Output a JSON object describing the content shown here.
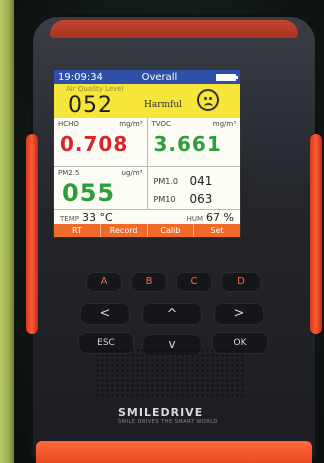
{
  "status_bar": {
    "time": "19:09:34",
    "mode": "Overall"
  },
  "aqi": {
    "caption": "Air Quality Level",
    "value": "052",
    "level": "Harmful"
  },
  "hcho": {
    "label": "HCHO",
    "unit": "mg/m³",
    "value": "0.708"
  },
  "tvoc": {
    "label": "TVOC",
    "unit": "mg/m³",
    "value": "3.661"
  },
  "pm25": {
    "label": "PM2.5",
    "unit": "ug/m³",
    "value": "055"
  },
  "pm1": {
    "label": "PM1.0",
    "value": "041"
  },
  "pm10": {
    "label": "PM10",
    "value": "063"
  },
  "temp": {
    "label": "TEMP",
    "value": "33 °C"
  },
  "hum": {
    "label": "HUM",
    "value": "67 %"
  },
  "menu": [
    "RT",
    "Record",
    "Calib",
    "Set"
  ],
  "keys": {
    "a": "A",
    "b": "B",
    "c": "C",
    "d": "D",
    "left": "<",
    "up": "^",
    "right": ">",
    "esc": "ESC",
    "down": "v",
    "ok": "OK"
  },
  "brand": {
    "name": "SMILEDRIVE",
    "tagline": "SMILE DRIVES THE SMART WORLD"
  },
  "colors": {
    "accent": "#f06a2a",
    "status_bar": "#2f4fa8",
    "aqi_panel": "#f6e63a",
    "hcho_value": "#d8242a",
    "tvoc_value": "#2c9f3a"
  }
}
